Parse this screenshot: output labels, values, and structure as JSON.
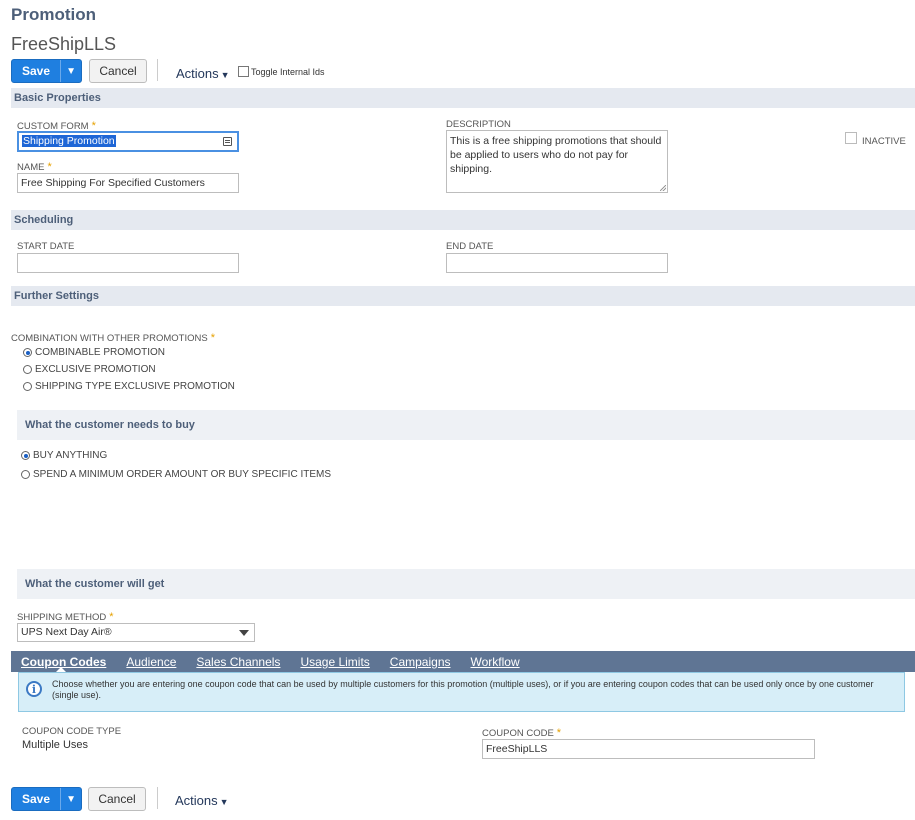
{
  "header": {
    "page_title": "Promotion",
    "record_name": "FreeShipLLS",
    "save_label": "Save",
    "save_menu_arrow": "▼",
    "cancel_label": "Cancel",
    "actions_label": "Actions",
    "toggle_internal_ids_label": "Toggle Internal Ids"
  },
  "basic_properties": {
    "section_title": "Basic Properties",
    "custom_form_label": "CUSTOM FORM",
    "custom_form_value": "Shipping Promotion",
    "name_label": "NAME",
    "name_value": "Free Shipping For Specified Customers",
    "description_label": "DESCRIPTION",
    "description_value": "This is a free shipping promotions that should be applied to users who do not pay for shipping.",
    "inactive_label": "INACTIVE"
  },
  "scheduling": {
    "section_title": "Scheduling",
    "start_date_label": "START DATE",
    "start_date_value": "",
    "end_date_label": "END DATE",
    "end_date_value": ""
  },
  "further_settings": {
    "section_title": "Further Settings",
    "combination_label": "COMBINATION WITH OTHER PROMOTIONS",
    "combination_options": [
      "COMBINABLE PROMOTION",
      "EXCLUSIVE PROMOTION",
      "SHIPPING TYPE EXCLUSIVE PROMOTION"
    ],
    "combination_selected": "COMBINABLE PROMOTION"
  },
  "customer_buy": {
    "section_title": "What the customer needs to buy",
    "options": [
      "BUY ANYTHING",
      "SPEND A MINIMUM ORDER AMOUNT OR BUY SPECIFIC ITEMS"
    ],
    "selected": "BUY ANYTHING"
  },
  "customer_get": {
    "section_title": "What the customer will get",
    "shipping_method_label": "SHIPPING METHOD",
    "shipping_method_value": "UPS Next Day Air®"
  },
  "subtabs": {
    "items": [
      "Coupon Codes",
      "Audience",
      "Sales Channels",
      "Usage Limits",
      "Campaigns",
      "Workflow"
    ],
    "active": "Coupon Codes",
    "info_text": "Choose whether you are entering one coupon code that can be used by multiple customers for this promotion (multiple uses), or if you are entering coupon codes that can be used only once by one customer (single use).",
    "coupon_code_type_label": "COUPON CODE TYPE",
    "coupon_code_type_value": "Multiple Uses",
    "coupon_code_label": "COUPON CODE",
    "coupon_code_value": "FreeShipLLS"
  },
  "footer": {
    "save_label": "Save",
    "save_menu_arrow": "▼",
    "cancel_label": "Cancel",
    "actions_label": "Actions"
  },
  "colors": {
    "primary_button": "#1f7fe0",
    "section_bar": "#e5e9f0",
    "subtab_bar": "#5f7594",
    "required_star": "#e6a100",
    "info_box": "#d7eef8"
  }
}
